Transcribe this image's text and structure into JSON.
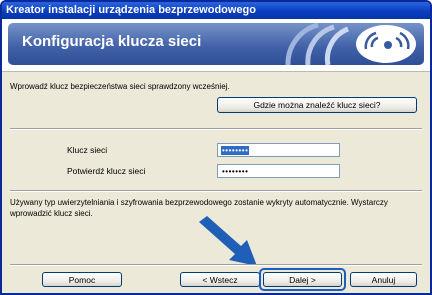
{
  "window": {
    "title": "Kreator instalacji urządzenia bezprzewodowego"
  },
  "header": {
    "title": "Konfiguracja klucza sieci",
    "icon": "wireless-signal-icon"
  },
  "intro_text": "Wprowadź klucz bezpieczeństwa sieci sprawdzony wcześniej.",
  "help_link_button": "Gdzie można znaleźć klucz sieci?",
  "fields": {
    "network_key": {
      "label": "Klucz sieci",
      "value": "••••••••"
    },
    "confirm_key": {
      "label": "Potwierdź klucz sieci",
      "value": "••••••••"
    }
  },
  "info_text": "Używany typ uwierzytelniania i szyfrowania bezprzewodowego zostanie wykryty automatycznie. Wystarczy wprowadzić klucz sieci.",
  "footer": {
    "help": "Pomoc",
    "back": "< Wstecz",
    "next": "Dalej >",
    "cancel": "Anuluj"
  },
  "colors": {
    "accent": "#316ac5",
    "arrow": "#1f5fb8",
    "titlebar": "#0b3fbf"
  }
}
